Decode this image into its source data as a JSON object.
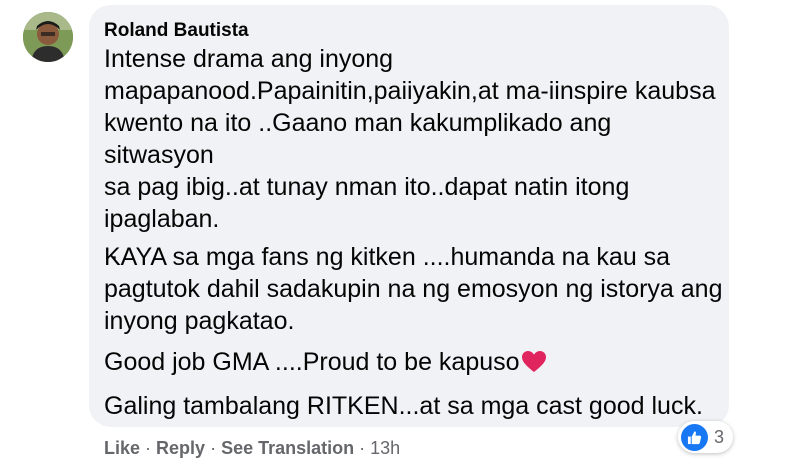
{
  "comment": {
    "author": "Roland Bautista",
    "paragraphs": [
      "Intense drama ang inyong\nmapapanood.Papainitin,paiiyakin,at ma-iinspire kaubsa\nkwento na ito ..Gaano man kakumplikado ang sitwasyon\nsa pag ibig..at tunay nman ito..dapat natin itong\nipaglaban.\n..",
      "KAYA sa mga fans ng kitken ....humanda na kau sa\npagtutok dahil sadakupin na ng emosyon ng istorya ang\ninyong pagkatao.",
      "Good job GMA ....Proud to be kapuso",
      "Galing tambalang RITKEN...at sa mga cast good luck."
    ],
    "heart_icon": "red-heart-icon"
  },
  "actions": {
    "like": "Like",
    "reply": "Reply",
    "see_translation": "See Translation",
    "separator": "·",
    "time": "13h"
  },
  "reactions": {
    "icon": "like-thumb-icon",
    "count": "3",
    "color": "#1877f2"
  },
  "colors": {
    "bubble": "#f0f2f5",
    "text": "#050505",
    "secondary": "#65676b",
    "heart": "#e0245e"
  }
}
